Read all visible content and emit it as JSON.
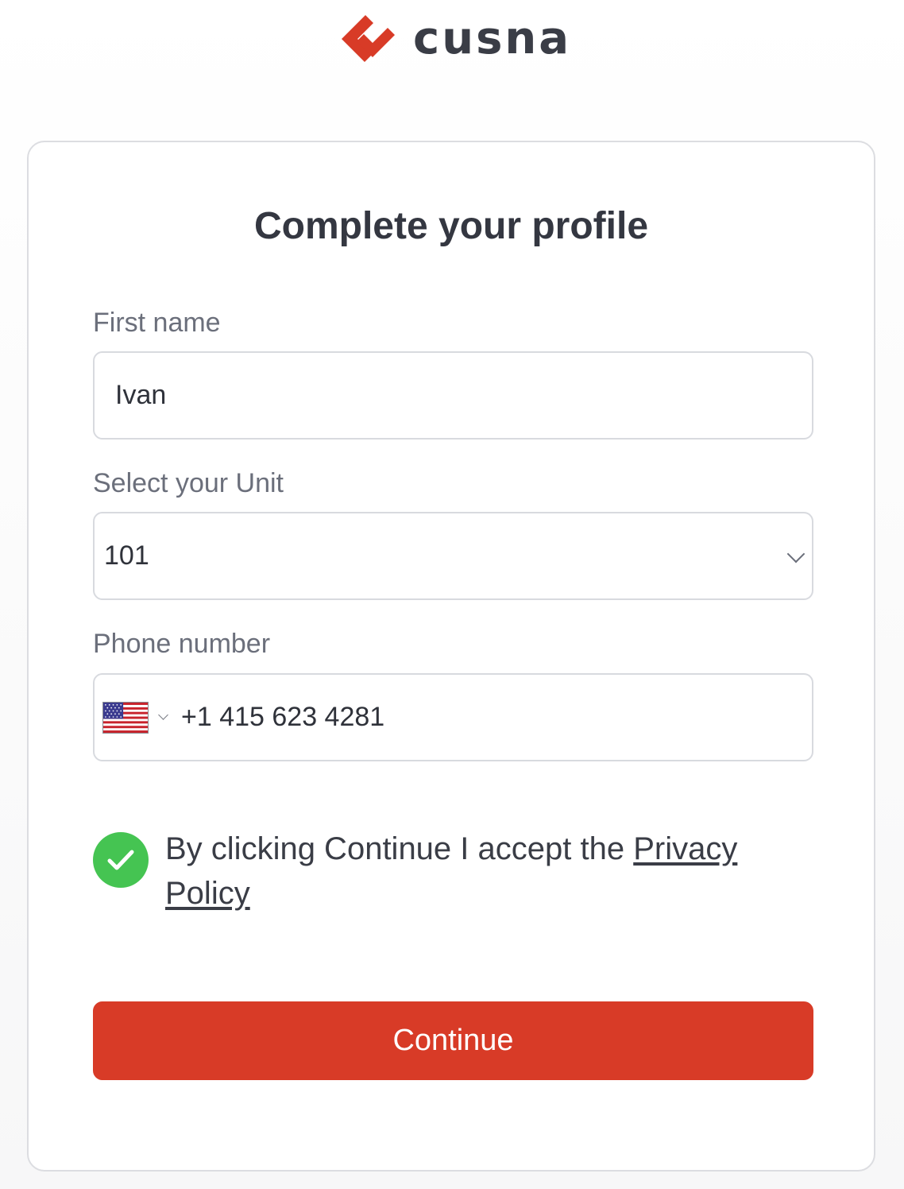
{
  "brand": {
    "name": "cusna",
    "logo_icon": "cusna-logo-icon",
    "accent_color": "#d83b27"
  },
  "form": {
    "title": "Complete your profile",
    "first_name": {
      "label": "First name",
      "value": "Ivan"
    },
    "unit": {
      "label": "Select your Unit",
      "value": "101"
    },
    "phone": {
      "label": "Phone number",
      "country_flag": "us-flag-icon",
      "value": "+1 415 623 4281"
    },
    "consent": {
      "checked": true,
      "text": "By clicking Continue I accept the",
      "link_text": "Privacy Policy"
    },
    "continue_label": "Continue",
    "success_color": "#45c452"
  }
}
